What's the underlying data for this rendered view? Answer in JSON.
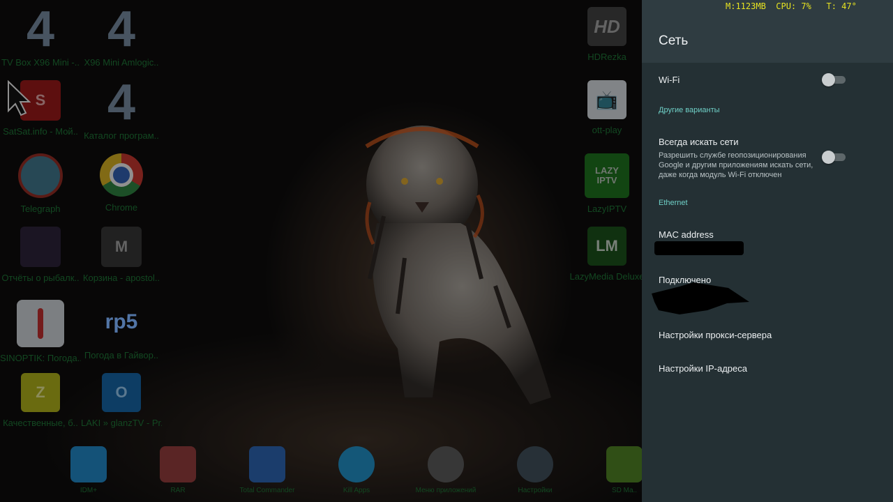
{
  "status_overlay": {
    "text": "M:1123MB  CPU: 7%   T: 47°"
  },
  "desktop": {
    "apps": [
      {
        "label": "TV Box X96 Mini -..",
        "icon": "four-icon",
        "glyph": "4"
      },
      {
        "label": "X96 Mini Amlogic..",
        "icon": "four-icon",
        "glyph": "4"
      },
      {
        "label": "SatSat.info - Мой..",
        "icon": "satsat-icon",
        "glyph": "S"
      },
      {
        "label": "Каталог програм..",
        "icon": "four-icon",
        "glyph": "4"
      },
      {
        "label": "Telegraph",
        "icon": "telegraph-icon",
        "glyph": ""
      },
      {
        "label": "Chrome",
        "icon": "chrome-icon",
        "glyph": ""
      },
      {
        "label": "Отчёты о рыбалк..",
        "icon": "fishing-icon",
        "glyph": ""
      },
      {
        "label": "Корзина - apostol..",
        "icon": "gmail-icon",
        "glyph": "M"
      },
      {
        "label": "SINOPTIK: Погода..",
        "icon": "thermometer-icon",
        "glyph": ""
      },
      {
        "label": "Погода в Гайвор..",
        "icon": "rp5-icon",
        "glyph": "rp5"
      },
      {
        "label": "Качественные, б..",
        "icon": "letter-z-icon",
        "glyph": "Z"
      },
      {
        "label": "LAKI » glanzTV - Pr..",
        "icon": "letter-o-icon",
        "glyph": "O"
      },
      {
        "label": "HDRezka",
        "icon": "hd-icon",
        "glyph": "HD"
      },
      {
        "label": "ott-play",
        "icon": "tv-icon",
        "glyph": "📺"
      },
      {
        "label": "LazyIPTV",
        "icon": "lazyiptv-icon",
        "glyph": "LAZY IPTV"
      },
      {
        "label": "LazyMedia Deluxe",
        "icon": "lazymedia-icon",
        "glyph": "LM"
      }
    ],
    "dock": [
      {
        "label": "IDM+",
        "icon": "download-icon"
      },
      {
        "label": "RAR",
        "icon": "rar-icon"
      },
      {
        "label": "Total Commander",
        "icon": "floppy-icon"
      },
      {
        "label": "Kill Apps",
        "icon": "trash-icon"
      },
      {
        "label": "Меню приложений",
        "icon": "app-drawer-icon"
      },
      {
        "label": "Настройки",
        "icon": "settings-icon"
      },
      {
        "label": "SD Ma..",
        "icon": "android-icon"
      }
    ]
  },
  "network_panel": {
    "title": "Сеть",
    "wifi": {
      "label": "Wi-Fi",
      "enabled": false
    },
    "other_section": "Другие варианты",
    "always_scan": {
      "label": "Всегда искать сети",
      "description": "Разрешить службе геопозиционирования Google и другим приложениям искать сети, даже когда модуль Wi-Fi отключен",
      "enabled": false
    },
    "ethernet_section": "Ethernet",
    "mac": {
      "label": "MAC address"
    },
    "connected": {
      "label": "Подключено"
    },
    "proxy": {
      "label": "Настройки прокси-сервера"
    },
    "ip": {
      "label": "Настройки IP-адреса"
    }
  }
}
